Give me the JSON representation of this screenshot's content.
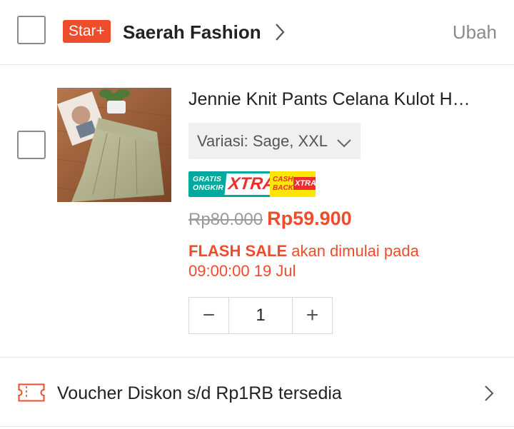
{
  "shop": {
    "badge": "Star+",
    "name": "Saerah Fashion",
    "edit_label": "Ubah"
  },
  "product": {
    "title": "Jennie Knit Pants Celana Kulot H…",
    "variation": "Variasi: Sage, XXL",
    "promo": {
      "gratis_line1": "GRATIS",
      "gratis_line2": "ONGKIR",
      "gratis_xtra": "XTRA",
      "cash_line1": "CASH",
      "cash_line2": "BACK",
      "cash_xtra": "XTRA"
    },
    "price_original": "Rp80.000",
    "price_current": "Rp59.900",
    "flash_sale_label": "FLASH SALE",
    "flash_sale_text": " akan dimulai pada 09:00:00 19 Jul",
    "quantity": "1",
    "qty_decrease": "−",
    "qty_increase": "+"
  },
  "voucher": {
    "text": "Voucher Diskon s/d Rp1RB tersedia"
  },
  "colors": {
    "accent": "#ee4d2d",
    "muted": "#8a8a8a",
    "gratis_teal": "#00a99d",
    "cashback_yellow": "#ffe600"
  }
}
